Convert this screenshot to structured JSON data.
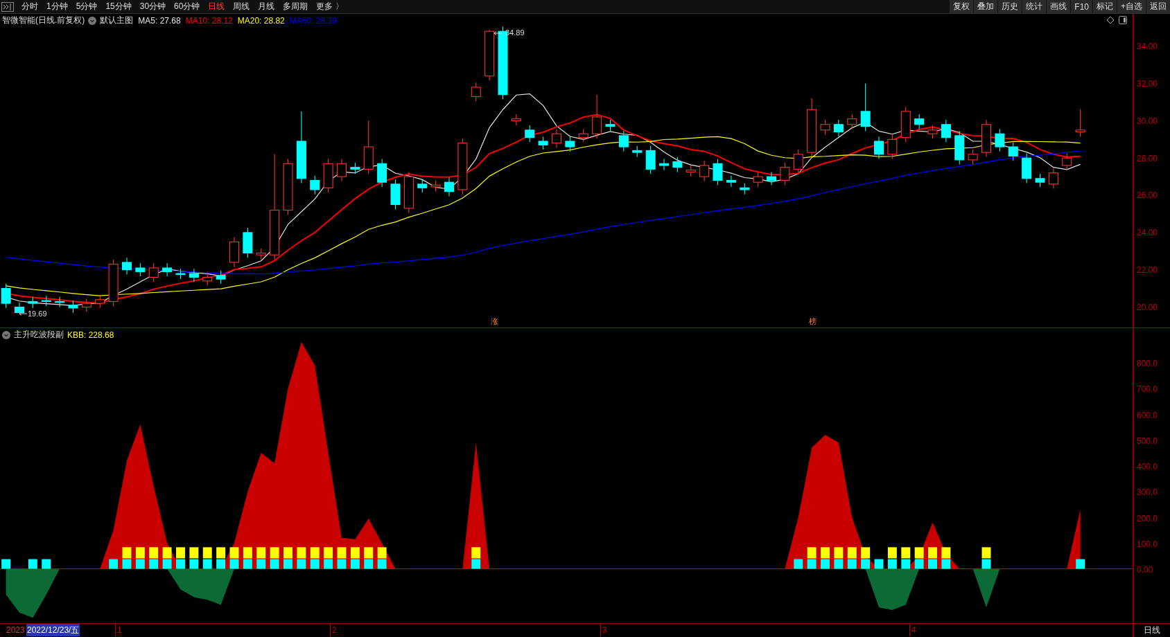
{
  "toolbar": {
    "periods": [
      {
        "label": "分时",
        "selected": false
      },
      {
        "label": "1分钟",
        "selected": false
      },
      {
        "label": "5分钟",
        "selected": false
      },
      {
        "label": "15分钟",
        "selected": false
      },
      {
        "label": "30分钟",
        "selected": false
      },
      {
        "label": "60分钟",
        "selected": false
      },
      {
        "label": "日线",
        "selected": true
      },
      {
        "label": "周线",
        "selected": false
      },
      {
        "label": "月线",
        "selected": false
      },
      {
        "label": "多周期",
        "selected": false
      },
      {
        "label": "更多 〉",
        "selected": false
      }
    ],
    "buttons": [
      "复权",
      "叠加",
      "历史",
      "统计",
      "画线",
      "F10",
      "标记",
      "+自选",
      "返回"
    ]
  },
  "main_panel": {
    "stock": "智微智能(日线.前复权)",
    "template": "默认主图",
    "indicators": [
      {
        "label": "MA5: 27.68",
        "color": "#e6e6e6"
      },
      {
        "label": "MA10: 28.12",
        "color": "#ff0000"
      },
      {
        "label": "MA20: 28.82",
        "color": "#ffff00"
      },
      {
        "label": "MA60: 28.39",
        "color": "#0000ff"
      }
    ],
    "high_label": "34.89",
    "low_label": "19.69",
    "markers": [
      "涨",
      "榜"
    ],
    "price_axis": [
      "34.00",
      "32.00",
      "30.00",
      "28.00",
      "26.00",
      "24.00",
      "22.00",
      "20.00"
    ]
  },
  "sub_panel": {
    "name": "主升吃波段副",
    "reading": "KBB: 228.68",
    "value_axis": [
      "800.0",
      "700.0",
      "600.0",
      "500.0",
      "400.0",
      "300.0",
      "200.0",
      "100.0",
      "0.00"
    ]
  },
  "time_axis": {
    "year": "2023",
    "cursor_date": "2022/12/23/五",
    "months": [
      "1",
      "2",
      "3",
      "4"
    ],
    "period": "日线"
  }
}
